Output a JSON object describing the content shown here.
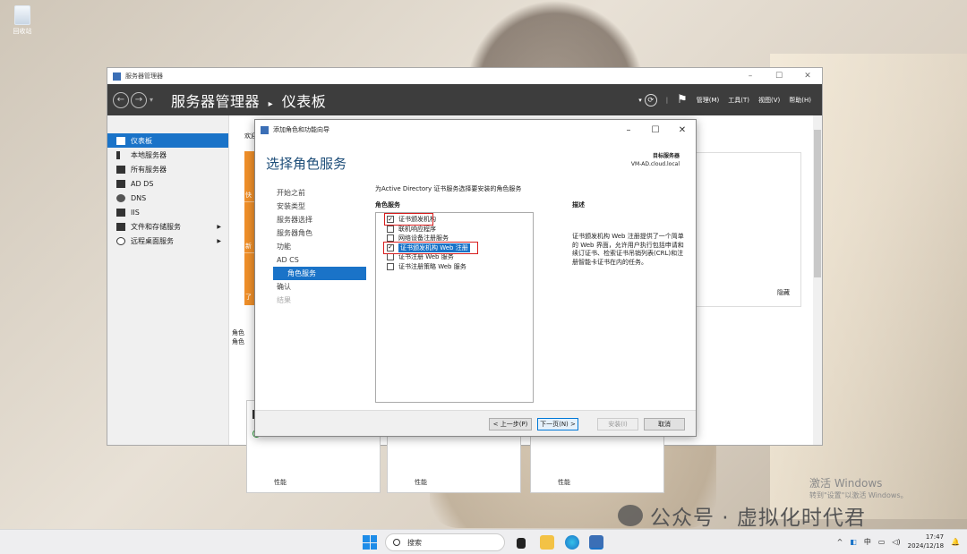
{
  "desktop": {
    "recycle_bin_label": "回收站"
  },
  "server_manager": {
    "window_title": "服务器管理器",
    "breadcrumb_app": "服务器管理器",
    "breadcrumb_sep": "▸",
    "breadcrumb_page": "仪表板",
    "menu": [
      "管理(M)",
      "工具(T)",
      "视图(V)",
      "帮助(H)"
    ],
    "nav": [
      {
        "label": "仪表板",
        "icon": "dashboard-icon",
        "active": true
      },
      {
        "label": "本地服务器",
        "icon": "server-icon"
      },
      {
        "label": "所有服务器",
        "icon": "servers-icon"
      },
      {
        "label": "AD DS",
        "icon": "ad-ds-icon"
      },
      {
        "label": "DNS",
        "icon": "dns-icon"
      },
      {
        "label": "IIS",
        "icon": "iis-icon"
      },
      {
        "label": "文件和存储服务",
        "icon": "storage-icon",
        "expandable": true
      },
      {
        "label": "远程桌面服务",
        "icon": "remote-desktop-icon",
        "expandable": true
      }
    ],
    "welcome_fragment": "欢迎",
    "quick_tabs": [
      "快",
      "新",
      "了"
    ],
    "roles_fragment_1": "角色",
    "roles_fragment_2": "角色",
    "hide_label": "隐藏",
    "tile_captions": [
      "性能",
      "性能",
      "性能"
    ]
  },
  "wizard": {
    "window_title": "添加角色和功能向导",
    "heading": "选择角色服务",
    "dest_label": "目标服务器",
    "dest_server": "VM-AD.cloud.local",
    "steps": [
      {
        "label": "开始之前",
        "state": "normal"
      },
      {
        "label": "安装类型",
        "state": "normal"
      },
      {
        "label": "服务器选择",
        "state": "normal"
      },
      {
        "label": "服务器角色",
        "state": "normal"
      },
      {
        "label": "功能",
        "state": "normal"
      },
      {
        "label": "AD CS",
        "state": "normal"
      },
      {
        "label": "角色服务",
        "state": "active"
      },
      {
        "label": "确认",
        "state": "normal"
      },
      {
        "label": "结果",
        "state": "dim"
      }
    ],
    "instruction": "为Active Directory 证书服务选择要安装的角色服务",
    "roles_header": "角色服务",
    "role_services": [
      {
        "label": "证书颁发机构",
        "checked": true
      },
      {
        "label": "联机响应程序",
        "checked": false
      },
      {
        "label": "网络设备注册服务",
        "checked": false
      },
      {
        "label": "证书颁发机构 Web 注册",
        "checked": true,
        "selected": true
      },
      {
        "label": "证书注册 Web 服务",
        "checked": false
      },
      {
        "label": "证书注册策略 Web 服务",
        "checked": false
      }
    ],
    "desc_header": "描述",
    "description": "证书颁发机构 Web 注册提供了一个简单的 Web 界面，允许用户执行包括申请和续订证书、检索证书吊销列表(CRL)和注册智能卡证书在内的任务。",
    "buttons": {
      "prev": "< 上一步(P)",
      "next": "下一页(N) >",
      "install": "安装(I)",
      "cancel": "取消"
    }
  },
  "watermark": {
    "activate_title": "激活 Windows",
    "activate_sub": "转到\"设置\"以激活 Windows。",
    "wechat": "公众号 · 虚拟化时代君"
  },
  "taskbar": {
    "search_placeholder": "搜索",
    "tray_lang": "中",
    "time": "17:47",
    "date": "2024/12/18"
  },
  "colors": {
    "accent": "#1a73c8",
    "highlight_box": "#d81e1e",
    "sm_bar": "#3d3d3d",
    "orange": "#f0902a"
  }
}
